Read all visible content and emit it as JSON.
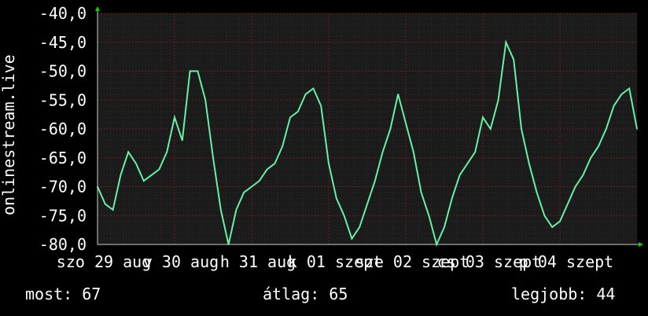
{
  "chart_data": {
    "type": "line",
    "ylabel": "onlinestream.live",
    "ylim": [
      -80,
      -40
    ],
    "yticks": [
      "-40,0",
      "-45,0",
      "-50,0",
      "-55,0",
      "-60,0",
      "-65,0",
      "-70,0",
      "-75,0",
      "-80,0"
    ],
    "ytick_values": [
      -40,
      -45,
      -50,
      -55,
      -60,
      -65,
      -70,
      -75,
      -80
    ],
    "xticks": [
      "szo 29 aug",
      "v 30 aug",
      "h 31 aug",
      "k 01 szept",
      "sze 02 szept",
      "cs 03 szept",
      "p 04 szept"
    ],
    "grid": true,
    "colors": {
      "background": "#000000",
      "plot": "#1b1b1b",
      "grid": "#6b1f1f",
      "line": "#66f0a8",
      "text": "#ffffff",
      "arrow": "#00d800"
    },
    "x": [
      0.0,
      0.1,
      0.2,
      0.3,
      0.4,
      0.5,
      0.6,
      0.7,
      0.8,
      0.9,
      1.0,
      1.1,
      1.2,
      1.3,
      1.4,
      1.5,
      1.6,
      1.7,
      1.8,
      1.9,
      2.0,
      2.1,
      2.2,
      2.3,
      2.4,
      2.5,
      2.6,
      2.7,
      2.8,
      2.9,
      3.0,
      3.1,
      3.2,
      3.3,
      3.4,
      3.5,
      3.6,
      3.7,
      3.8,
      3.9,
      4.0,
      4.1,
      4.2,
      4.3,
      4.4,
      4.5,
      4.6,
      4.7,
      4.8,
      4.9,
      5.0,
      5.1,
      5.2,
      5.3,
      5.4,
      5.5,
      5.6,
      5.7,
      5.8,
      5.9,
      6.0,
      6.1,
      6.2,
      6.3,
      6.4,
      6.5,
      6.6,
      6.7,
      6.8,
      6.9,
      7.0
    ],
    "values": [
      -70,
      -73,
      -74,
      -68,
      -64,
      -66,
      -69,
      -68,
      -67,
      -64,
      -58,
      -62,
      -50,
      -50,
      -55,
      -65,
      -74,
      -80,
      -74,
      -71,
      -70,
      -69,
      -67,
      -66,
      -63,
      -58,
      -57,
      -54,
      -53,
      -56,
      -66,
      -72,
      -75,
      -79,
      -77,
      -73,
      -69,
      -64,
      -60,
      -54,
      -59,
      -64,
      -71,
      -75,
      -80,
      -77,
      -72,
      -68,
      -66,
      -64,
      -58,
      -60,
      -55,
      -45,
      -48,
      -60,
      -66,
      -71,
      -75,
      -77,
      -76,
      -73,
      -70,
      -68,
      -65,
      -63,
      -60,
      -56,
      -54,
      -53,
      -60
    ]
  },
  "stats": {
    "now": "most: 67",
    "avg": "átlag: 65",
    "best": "legjobb: 44"
  }
}
